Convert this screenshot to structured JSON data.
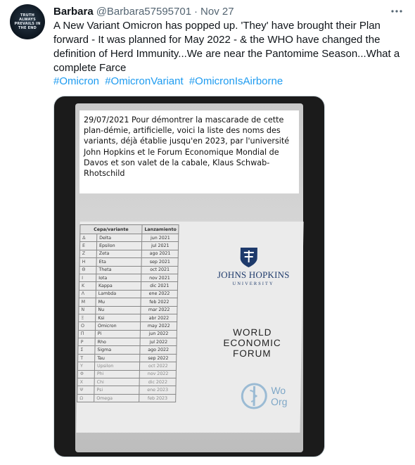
{
  "tweet": {
    "avatar_text": "TRUTH ALWAYS PREVAILS IN THE END",
    "name": "Barbara",
    "handle": "@Barbara57595701",
    "separator": "·",
    "date": "Nov 27",
    "more_icon": "more-icon",
    "text": "A New Variant Omicron has popped up. 'They' have brought their Plan forward - It was planned for May 2022 - & the WHO have changed the definition of Herd Immunity...We are near the Pantomime Season...What a complete Farce",
    "hashtags": [
      "#Omicron",
      "#OmicronVariant",
      "#OmicronIsAirborne"
    ],
    "colors": {
      "hashtag": "#1d9bf0",
      "secondary_text": "#536471"
    }
  },
  "image": {
    "caption": "29/07/2021 Pour démontrer la mascarade de cette plan-démie, artificielle, voici la liste des noms des variants, déjà établie jusqu'en 2023, par l'université John Hopkins et le Forum Economique Mondial de Davos et son valet de la cabale, Klaus Schwab-Rhotschild",
    "table": {
      "headers": [
        "Cepa/variante",
        "Lanzamiento"
      ],
      "rows": [
        {
          "greek": "Δ",
          "name": "Delta",
          "date": "jun 2021"
        },
        {
          "greek": "E",
          "name": "Epsilon",
          "date": "jul 2021"
        },
        {
          "greek": "Z",
          "name": "Zeta",
          "date": "ago 2021"
        },
        {
          "greek": "H",
          "name": "Eta",
          "date": "sep 2021"
        },
        {
          "greek": "Θ",
          "name": "Theta",
          "date": "oct 2021"
        },
        {
          "greek": "I",
          "name": "Iota",
          "date": "nov 2021"
        },
        {
          "greek": "K",
          "name": "Kappa",
          "date": "dic 2021"
        },
        {
          "greek": "Λ",
          "name": "Lambda",
          "date": "ene 2022"
        },
        {
          "greek": "M",
          "name": "Mu",
          "date": "feb 2022"
        },
        {
          "greek": "N",
          "name": "Nu",
          "date": "mar 2022"
        },
        {
          "greek": "Ξ",
          "name": "Ksi",
          "date": "abr 2022"
        },
        {
          "greek": "O",
          "name": "Omicron",
          "date": "may 2022"
        },
        {
          "greek": "Π",
          "name": "Pi",
          "date": "jun 2022"
        },
        {
          "greek": "P",
          "name": "Rho",
          "date": "jul 2022"
        },
        {
          "greek": "Σ",
          "name": "Sigma",
          "date": "ago 2022"
        },
        {
          "greek": "T",
          "name": "Tau",
          "date": "sep 2022"
        },
        {
          "greek": "Y",
          "name": "Upsilon",
          "date": "oct 2022"
        },
        {
          "greek": "Φ",
          "name": "Phi",
          "date": "nov 2022"
        },
        {
          "greek": "X",
          "name": "Chi",
          "date": "dic 2022"
        },
        {
          "greek": "Ψ",
          "name": "Psi",
          "date": "ene 2023"
        },
        {
          "greek": "Ω",
          "name": "Omega",
          "date": "feb 2023"
        }
      ]
    },
    "jhu": {
      "name": "JOHNS HOPKINS",
      "sub": "UNIVERSITY"
    },
    "wef": [
      "WORLD",
      "ECONOMIC",
      "FORUM"
    ],
    "who": [
      "Wo",
      "Org"
    ]
  }
}
